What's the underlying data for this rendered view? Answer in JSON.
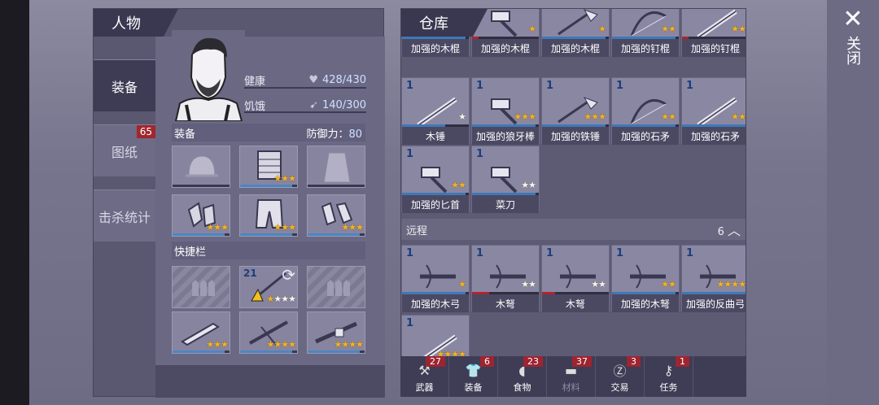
{
  "character": {
    "title": "人物",
    "tabs": [
      {
        "label": "装备",
        "active": true
      },
      {
        "label": "图纸",
        "badge": "65"
      },
      {
        "label": "击杀统计"
      }
    ],
    "health_label": "健康",
    "health_value": "428/430",
    "hunger_label": "饥饿",
    "hunger_value": "140/300",
    "equipment_label": "装备",
    "defense_label": "防御力：",
    "defense_value": "80",
    "quickbar_label": "快捷栏",
    "quickbar_count": "21"
  },
  "equipment_slots": [
    {
      "icon": "helmet-icon",
      "stars": 0
    },
    {
      "icon": "armor-vest-icon",
      "stars": 3
    },
    {
      "icon": "cloak-icon",
      "stars": 0
    },
    {
      "icon": "gloves-icon",
      "stars": 3
    },
    {
      "icon": "pants-icon",
      "stars": 3
    },
    {
      "icon": "boots-icon",
      "stars": 3
    }
  ],
  "storage": {
    "title": "仓库",
    "row1": [
      {
        "name": "加强的木棍",
        "stars": 1,
        "bar": 0.95,
        "red": false
      },
      {
        "name": "加强的木棍",
        "stars": 1,
        "bar": 0.1,
        "red": true
      },
      {
        "name": "加强的木棍",
        "stars": 1,
        "bar": 0.95,
        "red": false
      },
      {
        "name": "加强的钉棍",
        "stars": 2,
        "bar": 0.95,
        "red": false
      },
      {
        "name": "加强的钉棍",
        "stars": 2,
        "bar": 0.1,
        "red": true
      }
    ],
    "row2": [
      {
        "count": "1",
        "name": "木锤",
        "stars": 1,
        "white": true,
        "bar": 0.65
      },
      {
        "count": "1",
        "name": "加强的狼牙棒",
        "stars": 3,
        "bar": 0.95
      },
      {
        "count": "1",
        "name": "加强的铁锤",
        "stars": 3,
        "bar": 0.95
      },
      {
        "count": "1",
        "name": "加强的石矛",
        "stars": 2,
        "bar": 0.95
      },
      {
        "count": "1",
        "name": "加强的石矛",
        "stars": 2,
        "bar": 0.95
      }
    ],
    "row3": [
      {
        "count": "1",
        "name": "加强的匕首",
        "stars": 2,
        "bar": 0.95
      },
      {
        "count": "1",
        "name": "菜刀",
        "stars": 2,
        "white": true,
        "bar": 0.95
      }
    ],
    "ranged_label": "远程",
    "ranged_count": "6",
    "row4": [
      {
        "count": "1",
        "name": "加强的木弓",
        "stars": 1,
        "bar": 0.95
      },
      {
        "count": "1",
        "name": "木弩",
        "stars": 2,
        "white": true,
        "bar": 0.25,
        "red": true
      },
      {
        "count": "1",
        "name": "木弩",
        "stars": 2,
        "white": true,
        "bar": 0.2,
        "red": true
      },
      {
        "count": "1",
        "name": "加强的木弩",
        "stars": 2,
        "bar": 0.95
      },
      {
        "count": "1",
        "name": "加强的反曲弓",
        "stars": 4,
        "bar": 0.95
      }
    ],
    "row5": [
      {
        "count": "1",
        "name": "",
        "stars": 4
      }
    ]
  },
  "bottom_nav": [
    {
      "label": "武器",
      "badge": "27",
      "icon": "axe-icon"
    },
    {
      "label": "装备",
      "badge": "6",
      "icon": "shirt-icon"
    },
    {
      "label": "食物",
      "badge": "23",
      "icon": "food-icon"
    },
    {
      "label": "材料",
      "badge": "37",
      "icon": "material-icon",
      "dim": true
    },
    {
      "label": "交易",
      "badge": "3",
      "icon": "trade-coin-icon"
    },
    {
      "label": "任务",
      "badge": "1",
      "icon": "key-icon"
    }
  ],
  "close_label": "关闭"
}
